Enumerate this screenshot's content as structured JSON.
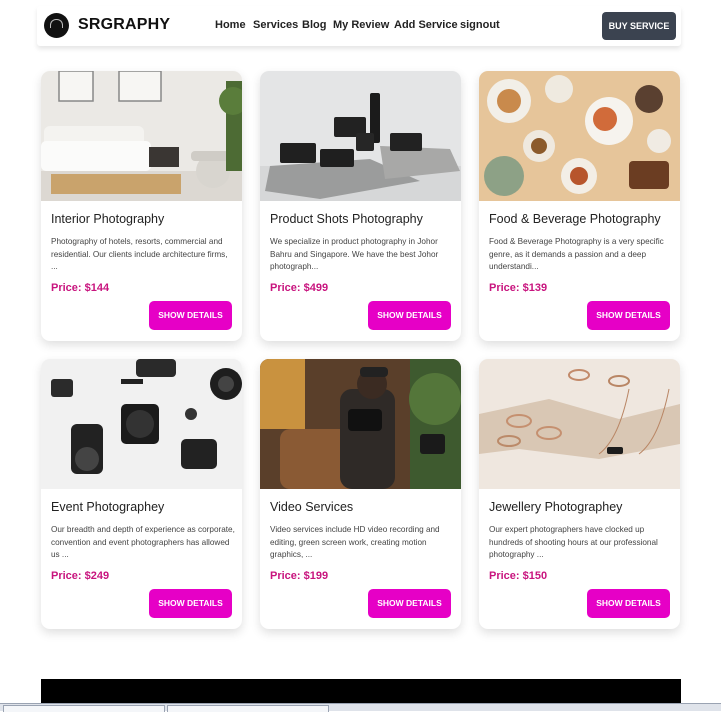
{
  "header": {
    "brand": "SRGRAPHY",
    "nav": [
      "Home",
      "Services",
      "Blog",
      "My Review",
      "Add Service",
      "signout"
    ],
    "cta": "BUY SERVICE"
  },
  "services": [
    {
      "title": "Interior Photography",
      "description": "Photography of hotels, resorts, commercial and residential. Our clients include architecture firms, ...",
      "price": "Price: $144",
      "button": "SHOW DETAILS"
    },
    {
      "title": "Product Shots Photography",
      "description": "We specialize in product photography in Johor Bahru and Singapore. We have the best Johor photograph...",
      "price": "Price: $499",
      "button": "SHOW DETAILS"
    },
    {
      "title": "Food & Beverage Photography",
      "description": "Food & Beverage Photography is a very specific genre, as it demands a passion and a deep understandi...",
      "price": "Price: $139",
      "button": "SHOW DETAILS"
    },
    {
      "title": "Event Photographey",
      "description": "Our breadth and depth of experience as corporate, convention and event photographers has allowed us ...",
      "price": "Price: $249",
      "button": "SHOW DETAILS"
    },
    {
      "title": "Video Services",
      "description": "Video services include HD video recording and editing, green screen work, creating motion graphics, ...",
      "price": "Price: $199",
      "button": "SHOW DETAILS"
    },
    {
      "title": "Jewellery Photographey",
      "description": "Our expert photographers have clocked up hundreds of shooting hours at our professional photography ...",
      "price": "Price: $150",
      "button": "SHOW DETAILS"
    }
  ],
  "colors": {
    "accent": "#e600c6",
    "price": "#c8147e",
    "cta": "#3b4350"
  }
}
